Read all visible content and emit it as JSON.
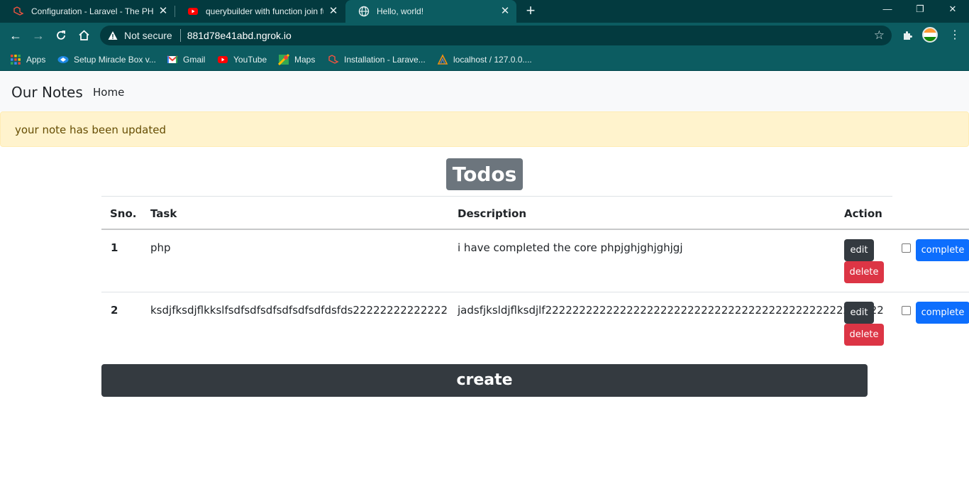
{
  "browser": {
    "tabs": [
      {
        "title": "Configuration - Laravel - The PHP",
        "favicon": "laravel-icon"
      },
      {
        "title": "querybuilder with function join fu",
        "favicon": "youtube-icon"
      },
      {
        "title": "Hello, world!",
        "favicon": "globe-icon"
      }
    ],
    "window_controls": {
      "minimize": "—",
      "restore": "❐",
      "close": "✕"
    },
    "address": {
      "security_label": "Not secure",
      "url": "881d78e41abd.ngrok.io"
    },
    "bookmarks": [
      {
        "label": "Apps",
        "icon": "apps-grid-icon"
      },
      {
        "label": "Setup Miracle Box v...",
        "icon": "miracle-box-icon"
      },
      {
        "label": "Gmail",
        "icon": "gmail-icon"
      },
      {
        "label": "YouTube",
        "icon": "youtube-icon"
      },
      {
        "label": "Maps",
        "icon": "maps-icon"
      },
      {
        "label": "Installation - Larave...",
        "icon": "laravel-icon"
      },
      {
        "label": "localhost / 127.0.0....",
        "icon": "phpmyadmin-icon"
      }
    ],
    "theme_colors": {
      "frame": "#033a3f",
      "toolbar": "#0c5c61"
    }
  },
  "app": {
    "brand": "Our Notes",
    "nav": {
      "home": "Home"
    },
    "alert": "your note has been updated",
    "heading": "Todos",
    "table": {
      "headers": {
        "sno": "Sno.",
        "task": "Task",
        "description": "Description",
        "action": "Action"
      },
      "rows": [
        {
          "sno": "1",
          "task": "php",
          "description": "i have completed the core phpjghjghjghjgj",
          "edit": "edit",
          "delete": "delete",
          "complete": "complete",
          "checked": false
        },
        {
          "sno": "2",
          "task": "ksdjfksdjflkkslfsdfsdfsdfsdfsdfsdfdsfds22222222222222",
          "description": "jadsfjksldjflksdjlf22222222222222222222222222222222222222222222222222",
          "edit": "edit",
          "delete": "delete",
          "complete": "complete",
          "checked": false
        }
      ]
    },
    "create_label": "create",
    "colors": {
      "alert_bg": "#fff3cd",
      "edit": "#343a40",
      "delete": "#dc3545",
      "complete": "#0d6efd",
      "heading_bg": "#6c757d"
    }
  }
}
